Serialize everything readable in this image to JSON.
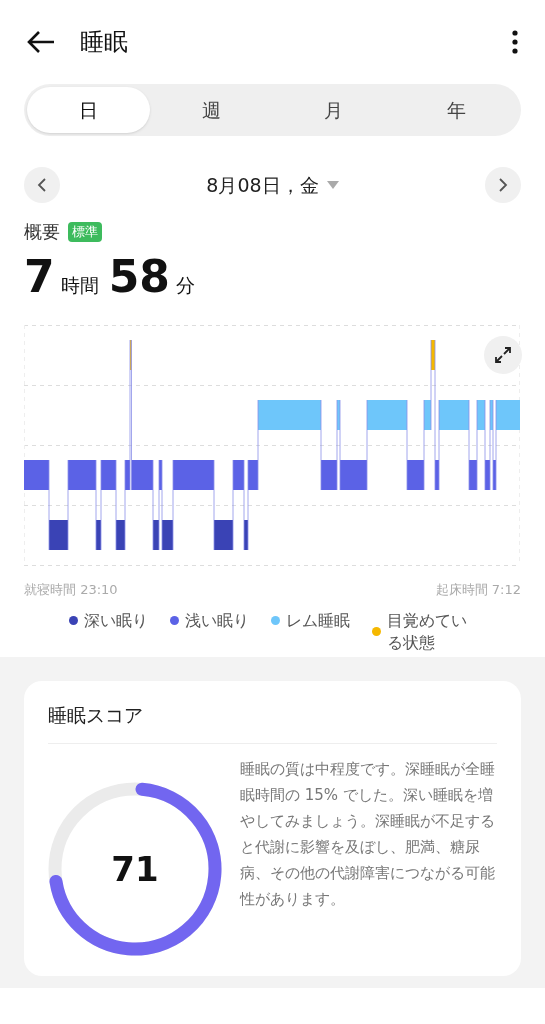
{
  "header": {
    "title": "睡眠"
  },
  "tabs": [
    {
      "label": "日",
      "selected": true
    },
    {
      "label": "週",
      "selected": false
    },
    {
      "label": "月",
      "selected": false
    },
    {
      "label": "年",
      "selected": false
    }
  ],
  "date": {
    "label": "8月08日，金"
  },
  "summary": {
    "label": "概要",
    "badge": "標準",
    "hours": "7",
    "hours_unit": "時間",
    "minutes": "58",
    "minutes_unit": "分"
  },
  "sleep_chart": {
    "bedtime": "就寝時間 23:10",
    "wake_time": "起床時間 7:12"
  },
  "legend": [
    {
      "label": "深い眠り",
      "color": "#3a43b5"
    },
    {
      "label": "浅い眠り",
      "color": "#5b62e6"
    },
    {
      "label": "レム睡眠",
      "color": "#6ec6fa"
    },
    {
      "label": "目覚めている状態",
      "color": "#f5b800"
    }
  ],
  "score_card": {
    "title": "睡眠スコア",
    "score": "71",
    "level": 0.71,
    "description": "睡眠の質は中程度です。深睡眠が全睡眠時間の 15% でした。深い睡眠を増やしてみましょう。深睡眠が不足すると代謝に影響を及ぼし、肥満、糖尿病、その他の代謝障害につながる可能性があります。"
  }
}
